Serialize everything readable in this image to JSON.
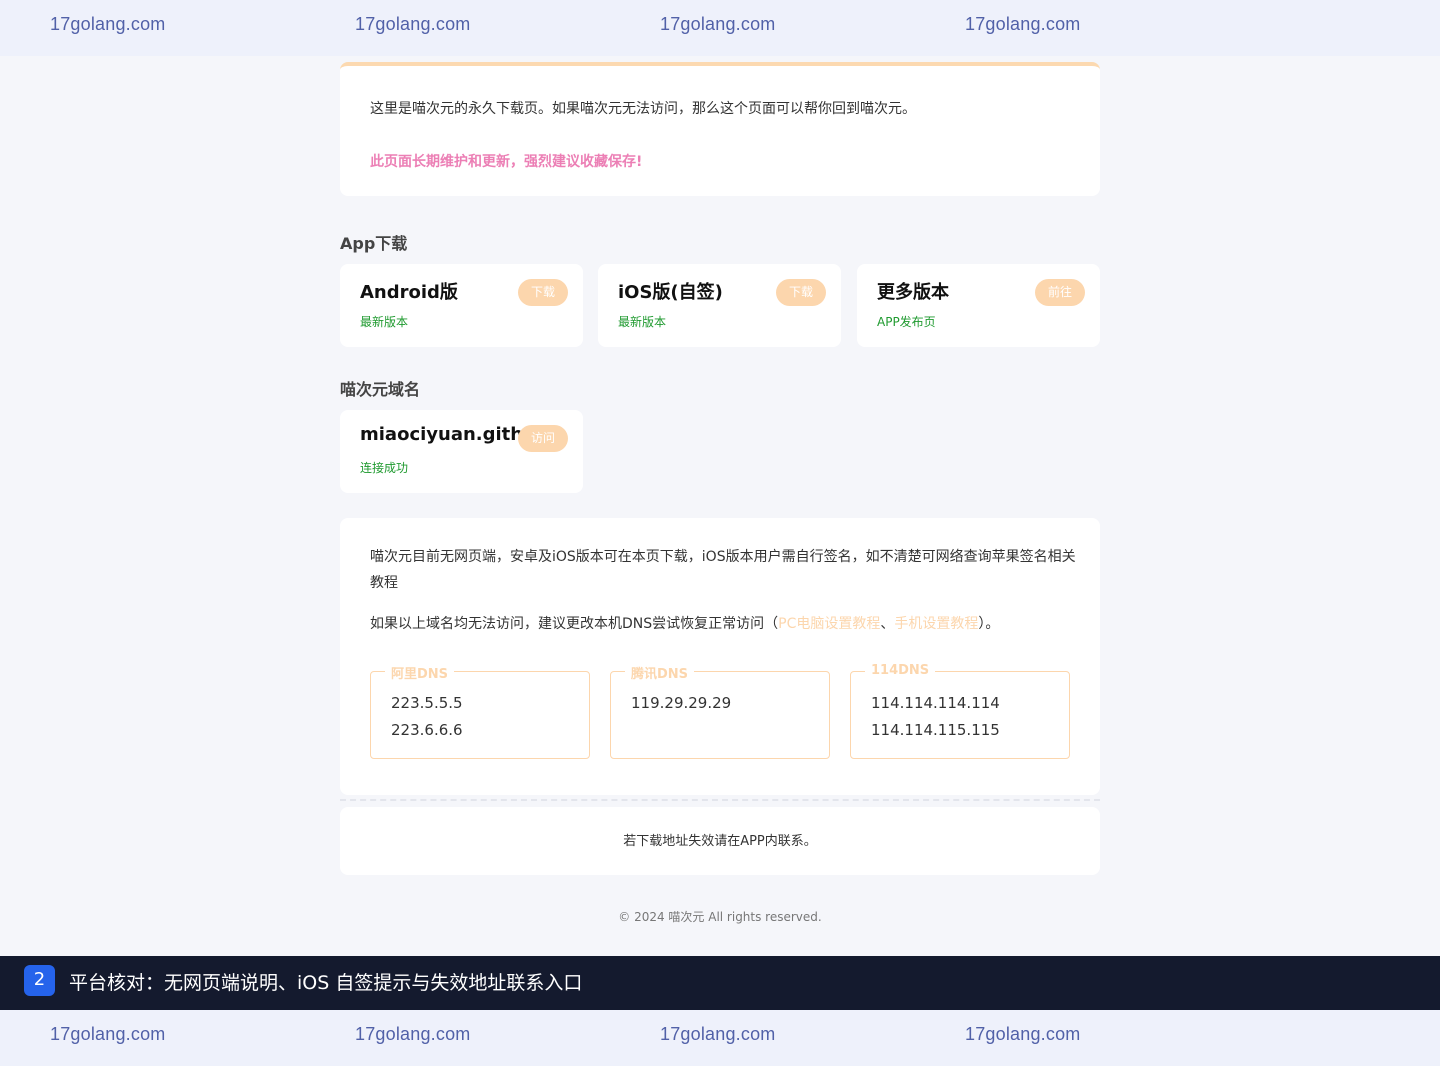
{
  "watermark": {
    "text": "17golang.com"
  },
  "notice": {
    "line1": "这里是喵次元的永久下载页。如果喵次元无法访问，那么这个页面可以帮你回到喵次元。",
    "line2": "此页面长期维护和更新，强烈建议收藏保存!"
  },
  "apps": {
    "title": "App下载",
    "items": [
      {
        "name": "Android版",
        "sub": "最新版本",
        "button": "下载"
      },
      {
        "name": "iOS版(自签)",
        "sub": "最新版本",
        "button": "下载"
      },
      {
        "name": "更多版本",
        "sub": "APP发布页",
        "button": "前往"
      }
    ]
  },
  "domains": {
    "title": "喵次元域名",
    "items": [
      {
        "name": "miaociyuan.github",
        "status": "连接成功",
        "button": "访问"
      }
    ]
  },
  "info": {
    "p1": "喵次元目前无网页端，安卓及iOS版本可在本页下载，iOS版本用户需自行签名，如不清楚可网络查询苹果签名相关教程",
    "p2_prefix": "如果以上域名均无法访问，建议更改本机DNS尝试恢复正常访问（",
    "p2_link1": "PC电脑设置教程",
    "p2_sep": "、",
    "p2_link2": "手机设置教程",
    "p2_suffix": "）。",
    "dns": [
      {
        "name": "阿里DNS",
        "values": [
          "223.5.5.5",
          "223.6.6.6"
        ]
      },
      {
        "name": "腾讯DNS",
        "values": [
          "119.29.29.29"
        ]
      },
      {
        "name": "114DNS",
        "values": [
          "114.114.114.114",
          "114.114.115.115"
        ]
      }
    ]
  },
  "footer": {
    "text": "若下载地址失效请在APP内联系。",
    "copyright": "© 2024 喵次元 All rights reserved."
  },
  "caption": {
    "badge": "2",
    "text": "平台核对：无网页端说明、iOS 自签提示与失效地址联系入口"
  },
  "colors": {
    "accent": "#fcd6ad",
    "success": "#1f9a2f",
    "highlight": "#ec7fb5",
    "badge": "#2563eb"
  }
}
